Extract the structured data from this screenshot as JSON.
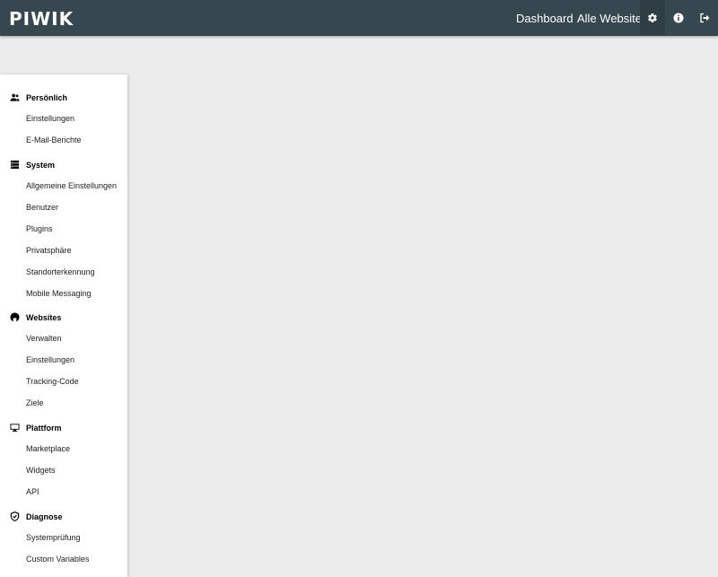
{
  "header": {
    "logo": "PIWIK",
    "nav": {
      "dashboard": "Dashboard",
      "all_websites": "Alle Websites"
    },
    "icons": [
      "gear-icon",
      "info-icon",
      "logout-icon"
    ]
  },
  "sidebar": {
    "sections": [
      {
        "title": "Persönlich",
        "icon": "users-icon",
        "items": [
          "Einstellungen",
          "E-Mail-Berichte"
        ]
      },
      {
        "title": "System",
        "icon": "server-icon",
        "items": [
          "Allgemeine Einstellungen",
          "Benutzer",
          "Plugins",
          "Privatsphäre",
          "Standorterkennung",
          "Mobile Messaging"
        ]
      },
      {
        "title": "Websites",
        "icon": "globe-icon",
        "items": [
          "Verwalten",
          "Einstellungen",
          "Tracking-Code",
          "Ziele"
        ]
      },
      {
        "title": "Plattform",
        "icon": "monitor-icon",
        "items": [
          "Marketplace",
          "Widgets",
          "API"
        ]
      },
      {
        "title": "Diagnose",
        "icon": "shield-icon",
        "items": [
          "Systemprüfung",
          "Custom Variables"
        ]
      }
    ]
  },
  "colors": {
    "topbar": "#37474f",
    "topbar_active": "#2f3d44",
    "page_background": "#ececec",
    "sidebar_background": "#ffffff"
  }
}
